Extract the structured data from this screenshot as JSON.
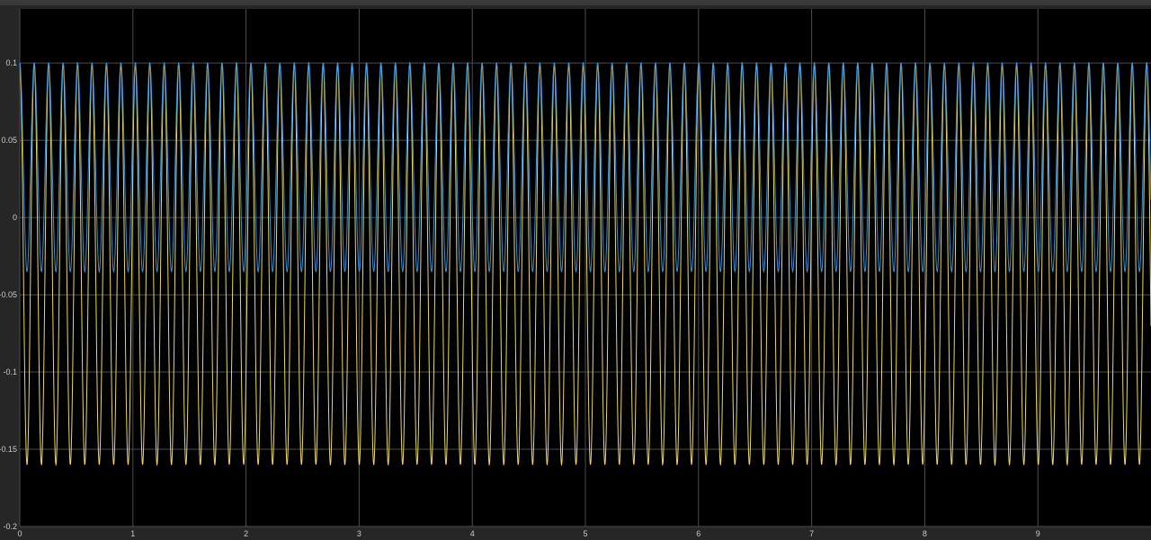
{
  "chart_data": {
    "type": "line",
    "title": "",
    "xlabel": "",
    "ylabel": "",
    "xlim": [
      0,
      10
    ],
    "ylim": [
      -0.2,
      0.135
    ],
    "grid": true,
    "legend": "none",
    "x_ticks": [
      0,
      1,
      2,
      3,
      4,
      5,
      6,
      7,
      8,
      9
    ],
    "x_tick_labels": [
      "0",
      "1",
      "2",
      "3",
      "4",
      "5",
      "6",
      "7",
      "8",
      "9"
    ],
    "y_ticks": [
      0.1,
      0.05,
      0,
      -0.05,
      -0.1,
      -0.15,
      -0.2
    ],
    "y_tick_labels": [
      "0.1",
      "0.05",
      "0",
      "-0.05",
      "-0.1",
      "-0.15",
      "-0.2"
    ],
    "series": [
      {
        "color": "#e8d86a",
        "frequency_hz": 7.83,
        "max": 0.1,
        "min": -0.16,
        "x_start": 0,
        "x_end": 10
      },
      {
        "color": "#3a8fd6",
        "frequency_hz": 7.83,
        "max": 0.1,
        "min": -0.035,
        "x_start": 0,
        "x_end": 10
      }
    ]
  },
  "colors": {
    "background": "#262626",
    "plot_area": "#000000",
    "grid": "#4d4d4d",
    "tick_text": "#c8c8c8"
  }
}
